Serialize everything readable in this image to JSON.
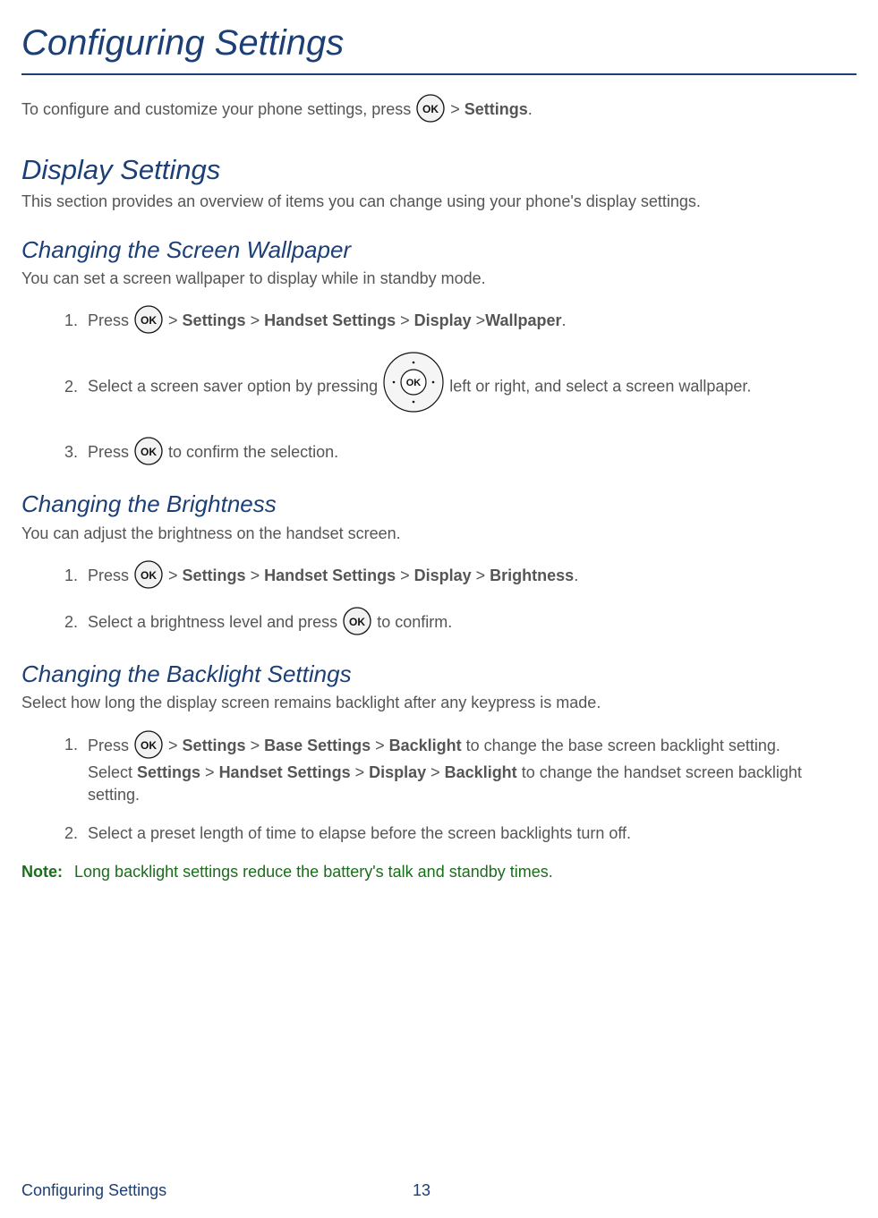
{
  "page_title": "Configuring Settings",
  "intro_before": "To configure and customize your phone settings, press ",
  "intro_after_gt": " > ",
  "intro_settings": "Settings",
  "intro_period": ".",
  "display": {
    "heading": "Display Settings",
    "blurb": "This section provides an overview of items you can change using your phone's display settings."
  },
  "wallpaper": {
    "heading": "Changing the Screen Wallpaper",
    "blurb": "You can set a screen wallpaper to display while in standby mode.",
    "step1_press": "Press ",
    "step1_path": {
      "s1": "Settings",
      "s2": "Handset Settings",
      "s3": "Display",
      "s4": "Wallpaper"
    },
    "step2_before": "Select a screen saver option by pressing ",
    "step2_after": " left or right, and select a screen wallpaper.",
    "step3_before": "Press ",
    "step3_after": " to confirm the selection."
  },
  "brightness": {
    "heading": "Changing the Brightness",
    "blurb": "You can adjust the brightness on the handset screen.",
    "step1_press": "Press ",
    "step1_path": {
      "s1": "Settings",
      "s2": "Handset Settings",
      "s3": "Display",
      "s4": "Brightness"
    },
    "step2_before": "Select a brightness level and press ",
    "step2_after": " to confirm."
  },
  "backlight": {
    "heading": "Changing the Backlight Settings",
    "blurb": "Select how long the display screen remains backlight after any keypress is made.",
    "step1_press": "Press ",
    "step1_path_a": {
      "s1": "Settings",
      "s2": "Base Settings",
      "s3": "Backlight"
    },
    "step1_tail_a": " to change the base screen backlight setting.",
    "step1_select": "Select ",
    "step1_path_b": {
      "s1": "Settings",
      "s2": "Handset Settings",
      "s3": "Display",
      "s4": "Backlight"
    },
    "step1_tail_b": " to change the handset screen backlight setting.",
    "step2": "Select a preset length of time to elapse before the screen backlights turn off."
  },
  "note": {
    "label": "Note:",
    "text": "Long backlight settings reduce the battery's talk and standby times."
  },
  "footer": {
    "title": "Configuring Settings",
    "page": "13"
  },
  "gt": " > ",
  "period": "."
}
